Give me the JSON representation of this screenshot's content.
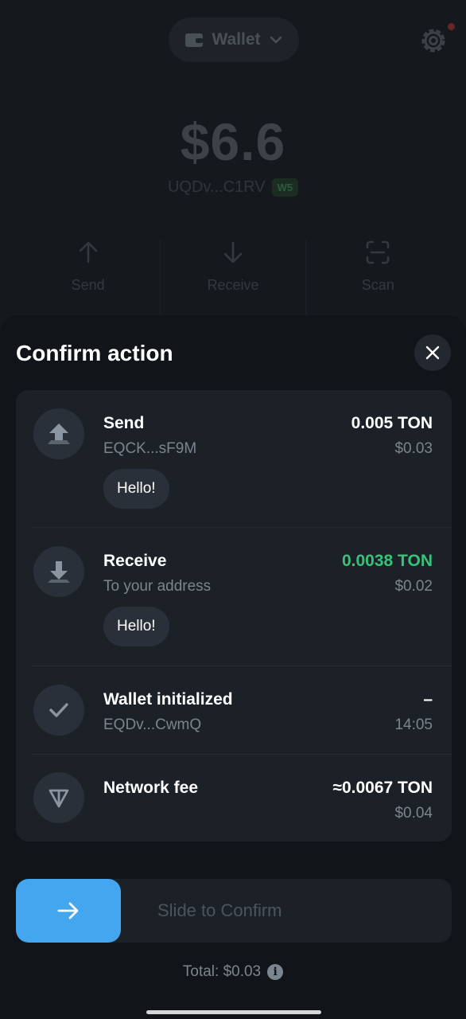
{
  "background": {
    "wallet_label": "Wallet",
    "balance": "$6.6",
    "address": "UQDv...C1RV",
    "version_badge": "W5",
    "actions": [
      {
        "label": "Send",
        "icon": "arrow-up-icon"
      },
      {
        "label": "Receive",
        "icon": "arrow-down-icon"
      },
      {
        "label": "Scan",
        "icon": "scan-icon"
      }
    ]
  },
  "sheet": {
    "title": "Confirm action",
    "rows": [
      {
        "title": "Send",
        "subtitle": "EQCK...sF9M",
        "amount": "0.005 TON",
        "fiat": "$0.03",
        "comment": "Hello!",
        "icon": "send-icon"
      },
      {
        "title": "Receive",
        "subtitle": "To your address",
        "amount": "0.0038 TON",
        "fiat": "$0.02",
        "comment": "Hello!",
        "icon": "receive-icon"
      },
      {
        "title": "Wallet initialized",
        "subtitle": "EQDv...CwmQ",
        "amount": "–",
        "fiat": "14:05",
        "icon": "check-icon"
      },
      {
        "title": "Network fee",
        "amount": "≈0.0067 TON",
        "fiat": "$0.04",
        "icon": "ton-icon"
      }
    ],
    "slider_label": "Slide to Confirm",
    "total": "Total: $0.03"
  },
  "colors": {
    "accent": "#44a6ee",
    "positive": "#39c17a",
    "card": "#1c2128",
    "sheet": "#111419"
  }
}
